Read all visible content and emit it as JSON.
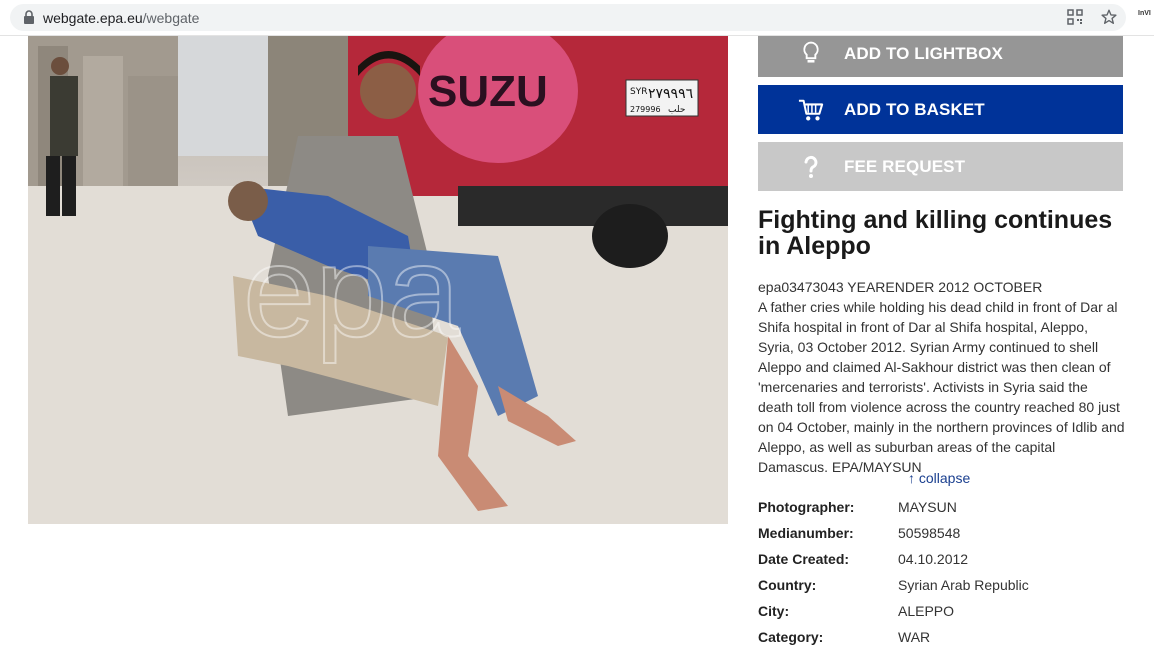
{
  "browser": {
    "url_host": "webgate.epa.eu",
    "url_path": "/webgate",
    "ext_label": "InVI"
  },
  "photo": {
    "watermark": "epa",
    "plate": "٢٧٩٩٩٦",
    "plate_sub": "279996",
    "plate_country": "SYR",
    "plate_city": "حلب",
    "wheel_text": "SUZU"
  },
  "actions": {
    "lightbox_label": "ADD TO LIGHTBOX",
    "basket_label": "ADD TO BASKET",
    "fee_label": "FEE REQUEST"
  },
  "article": {
    "title": "Fighting and killing continues in Aleppo",
    "caption_id": "epa03473043 YEARENDER 2012 OCTOBER",
    "caption_text": "A father cries while holding his dead child in front of Dar al Shifa hospital in front of Dar al Shifa hospital, Aleppo, Syria, 03 October 2012. Syrian Army continued to shell Aleppo and claimed Al-Sakhour district was then clean of 'mercenaries and terrorists'. Activists in Syria said the death toll from violence across the country reached 80 just on 04 October, mainly in the northern provinces of Idlib and Aleppo, as well as suburban areas of the capital Damascus. EPA/MAYSUN",
    "collapse_label": "↑ collapse"
  },
  "metadata": [
    {
      "key": "Photographer:",
      "value": "MAYSUN"
    },
    {
      "key": "Medianumber:",
      "value": "50598548"
    },
    {
      "key": "Date Created:",
      "value": "04.10.2012"
    },
    {
      "key": "Country:",
      "value": "Syrian Arab Republic"
    },
    {
      "key": "City:",
      "value": "ALEPPO"
    },
    {
      "key": "Category:",
      "value": "WAR"
    }
  ],
  "colors": {
    "basket": "#003399",
    "lightbox": "#969696",
    "fee": "#c8c8c8"
  }
}
